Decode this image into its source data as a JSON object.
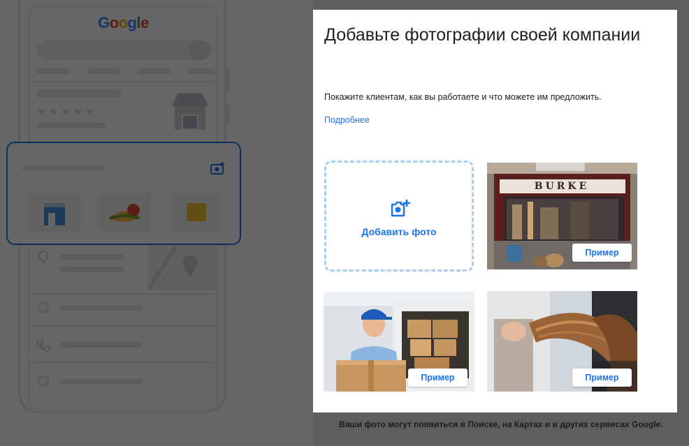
{
  "illustration": {
    "logo_text": "Google"
  },
  "dialog": {
    "title": "Добавьте фотографии своей компании",
    "description": "Покажите клиентам, как вы работаете и что можете им предложить.",
    "learn_more": "Подробнее",
    "add_photo_label": "Добавить фото",
    "photos": [
      {
        "subject": "storefront",
        "sign_text": "BURKE",
        "example_label": "Пример"
      },
      {
        "subject": "delivery-worker",
        "example_label": "Пример"
      },
      {
        "subject": "hairdresser",
        "example_label": "Пример"
      }
    ],
    "accent_color": "#1a73e8"
  },
  "footer": {
    "note": "Ваши фото могут появиться в Поиске, на Картах и в других сервисах Google."
  }
}
